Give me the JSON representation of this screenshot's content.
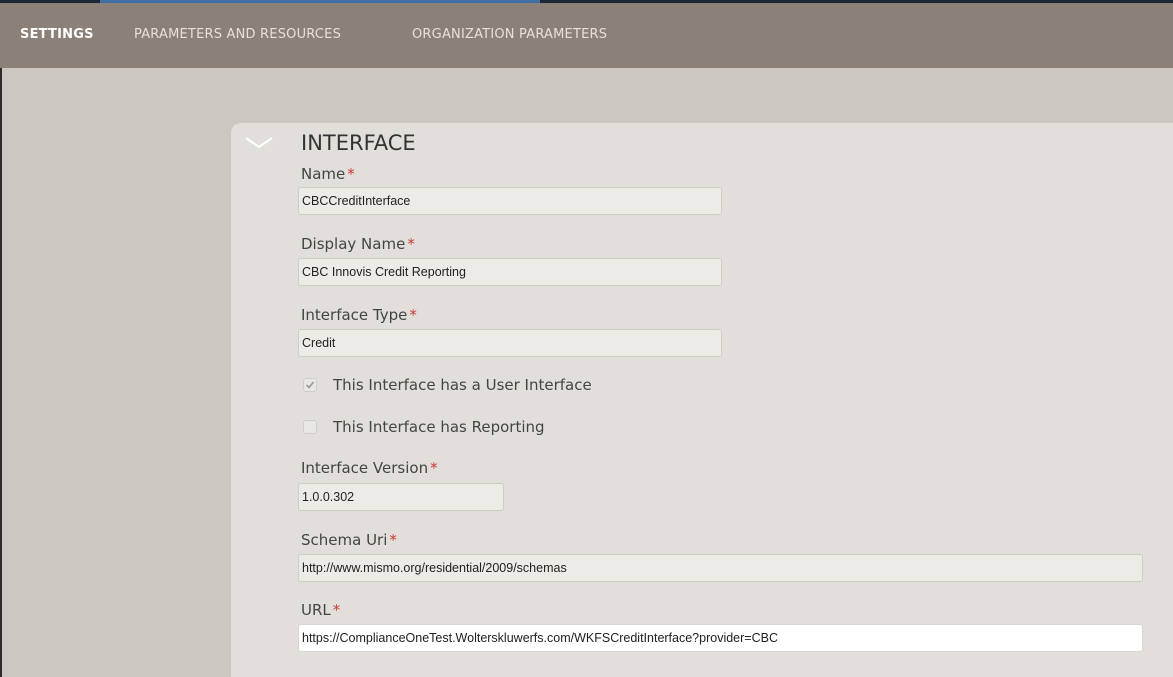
{
  "tabs": [
    {
      "label": "SETTINGS",
      "active": true
    },
    {
      "label": "PARAMETERS AND RESOURCES",
      "active": false
    },
    {
      "label": "ORGANIZATION PARAMETERS",
      "active": false
    }
  ],
  "section": {
    "title": "INTERFACE"
  },
  "fields": {
    "name": {
      "label": "Name",
      "required": "*",
      "value": "CBCCreditInterface"
    },
    "display_name": {
      "label": "Display Name",
      "required": "*",
      "value": "CBC Innovis Credit Reporting"
    },
    "interface_type": {
      "label": "Interface Type",
      "required": "*",
      "value": "Credit"
    },
    "interface_version": {
      "label": "Interface Version",
      "required": "*",
      "value": "1.0.0.302"
    },
    "schema_uri": {
      "label": "Schema Uri",
      "required": "*",
      "value": "http://www.mismo.org/residential/2009/schemas"
    },
    "url": {
      "label": "URL",
      "required": "*",
      "value": "https://ComplianceOneTest.Wolterskluwerfs.com/WKFSCreditInterface?provider=CBC"
    }
  },
  "checkboxes": {
    "user_interface": {
      "label": "This Interface has a User Interface",
      "checked": true
    },
    "reporting": {
      "label": "This Interface has Reporting",
      "checked": false
    }
  },
  "colors": {
    "topbar": "#8b8178",
    "accent": "#3f6fa6",
    "required": "#cc3a33"
  }
}
